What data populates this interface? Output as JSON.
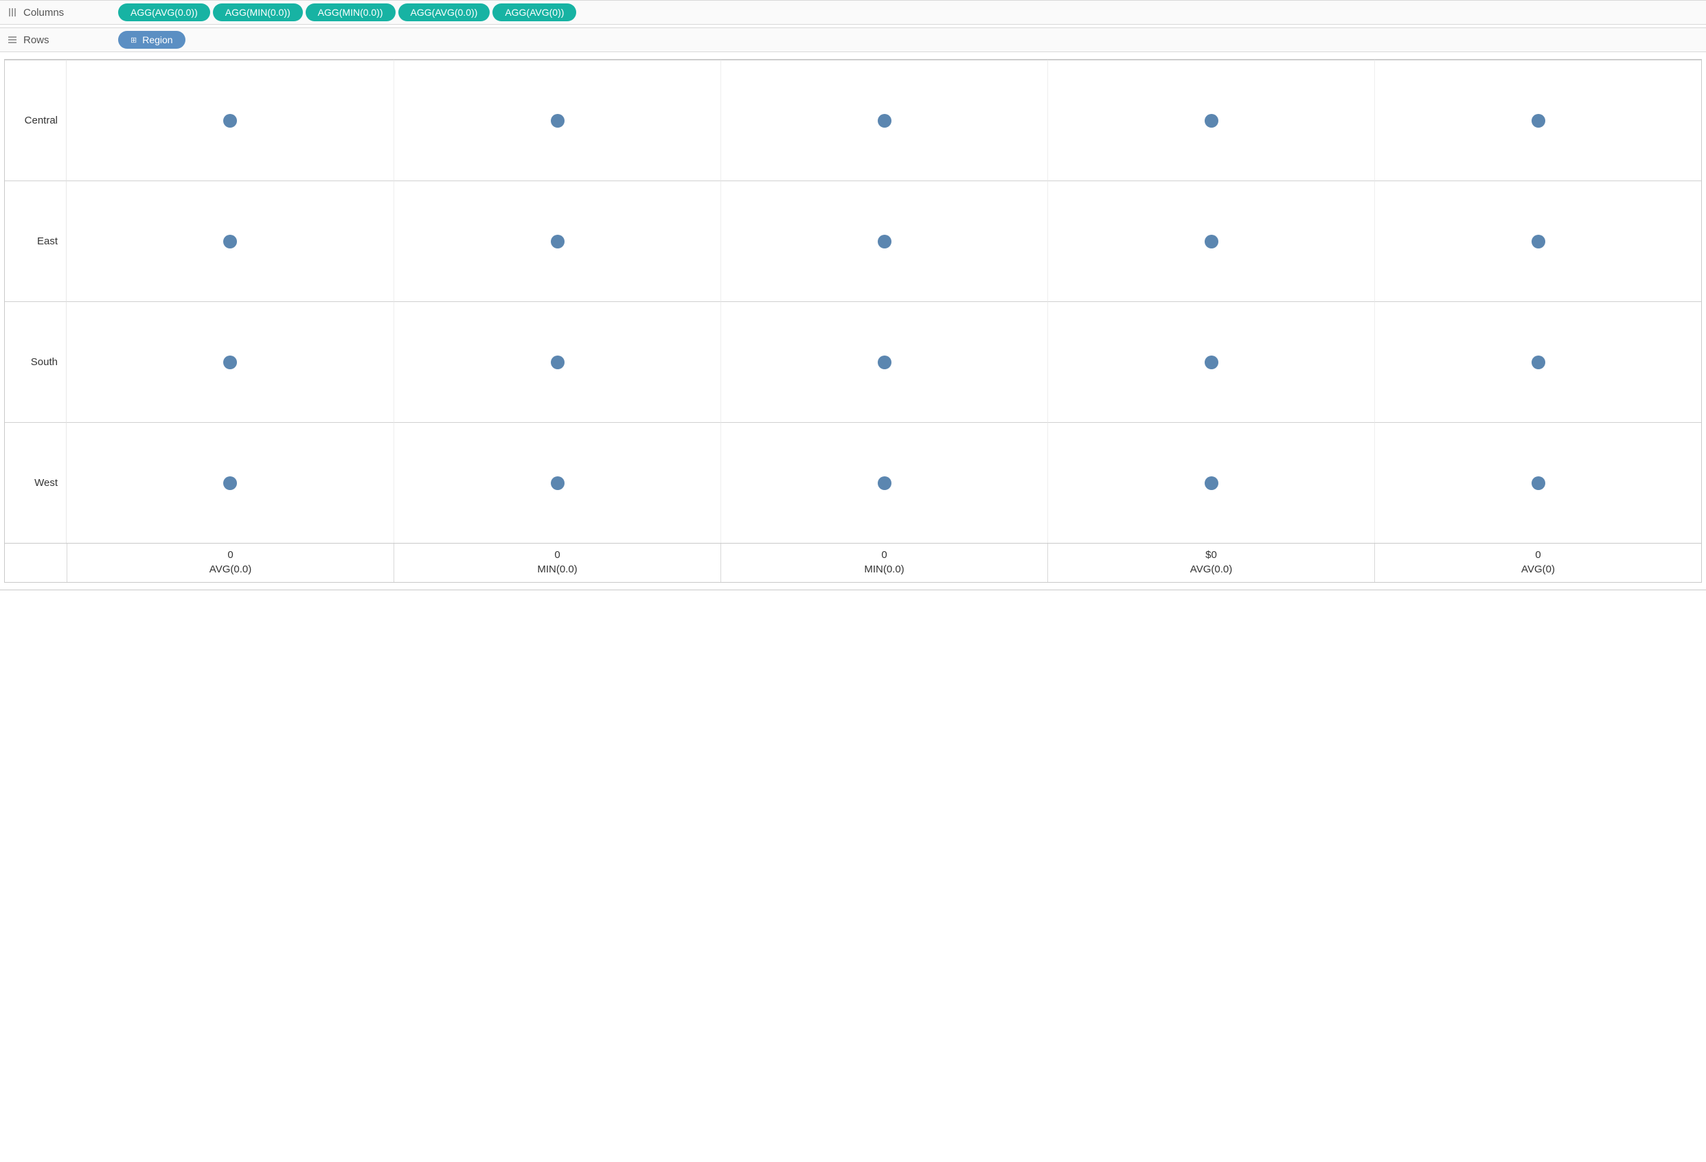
{
  "shelves": {
    "columns_label": "Columns",
    "rows_label": "Rows",
    "column_pills": [
      "AGG(AVG(0.0))",
      "AGG(MIN(0.0))",
      "AGG(MIN(0.0))",
      "AGG(AVG(0.0))",
      "AGG(AVG(0))"
    ],
    "row_pill": "Region"
  },
  "chart_data": {
    "type": "scatter",
    "row_field": "Region",
    "categories": [
      "Central",
      "East",
      "South",
      "West"
    ],
    "series": [
      {
        "name": "AVG(0.0)",
        "axis_tick": "0",
        "values": [
          0,
          0,
          0,
          0
        ]
      },
      {
        "name": "MIN(0.0)",
        "axis_tick": "0",
        "values": [
          0,
          0,
          0,
          0
        ]
      },
      {
        "name": "MIN(0.0)",
        "axis_tick": "0",
        "values": [
          0,
          0,
          0,
          0
        ]
      },
      {
        "name": "AVG(0.0)",
        "axis_tick": "$0",
        "values": [
          0,
          0,
          0,
          0
        ]
      },
      {
        "name": "AVG(0)",
        "axis_tick": "0",
        "values": [
          0,
          0,
          0,
          0
        ]
      }
    ],
    "mark_color": "#5b86b0"
  }
}
